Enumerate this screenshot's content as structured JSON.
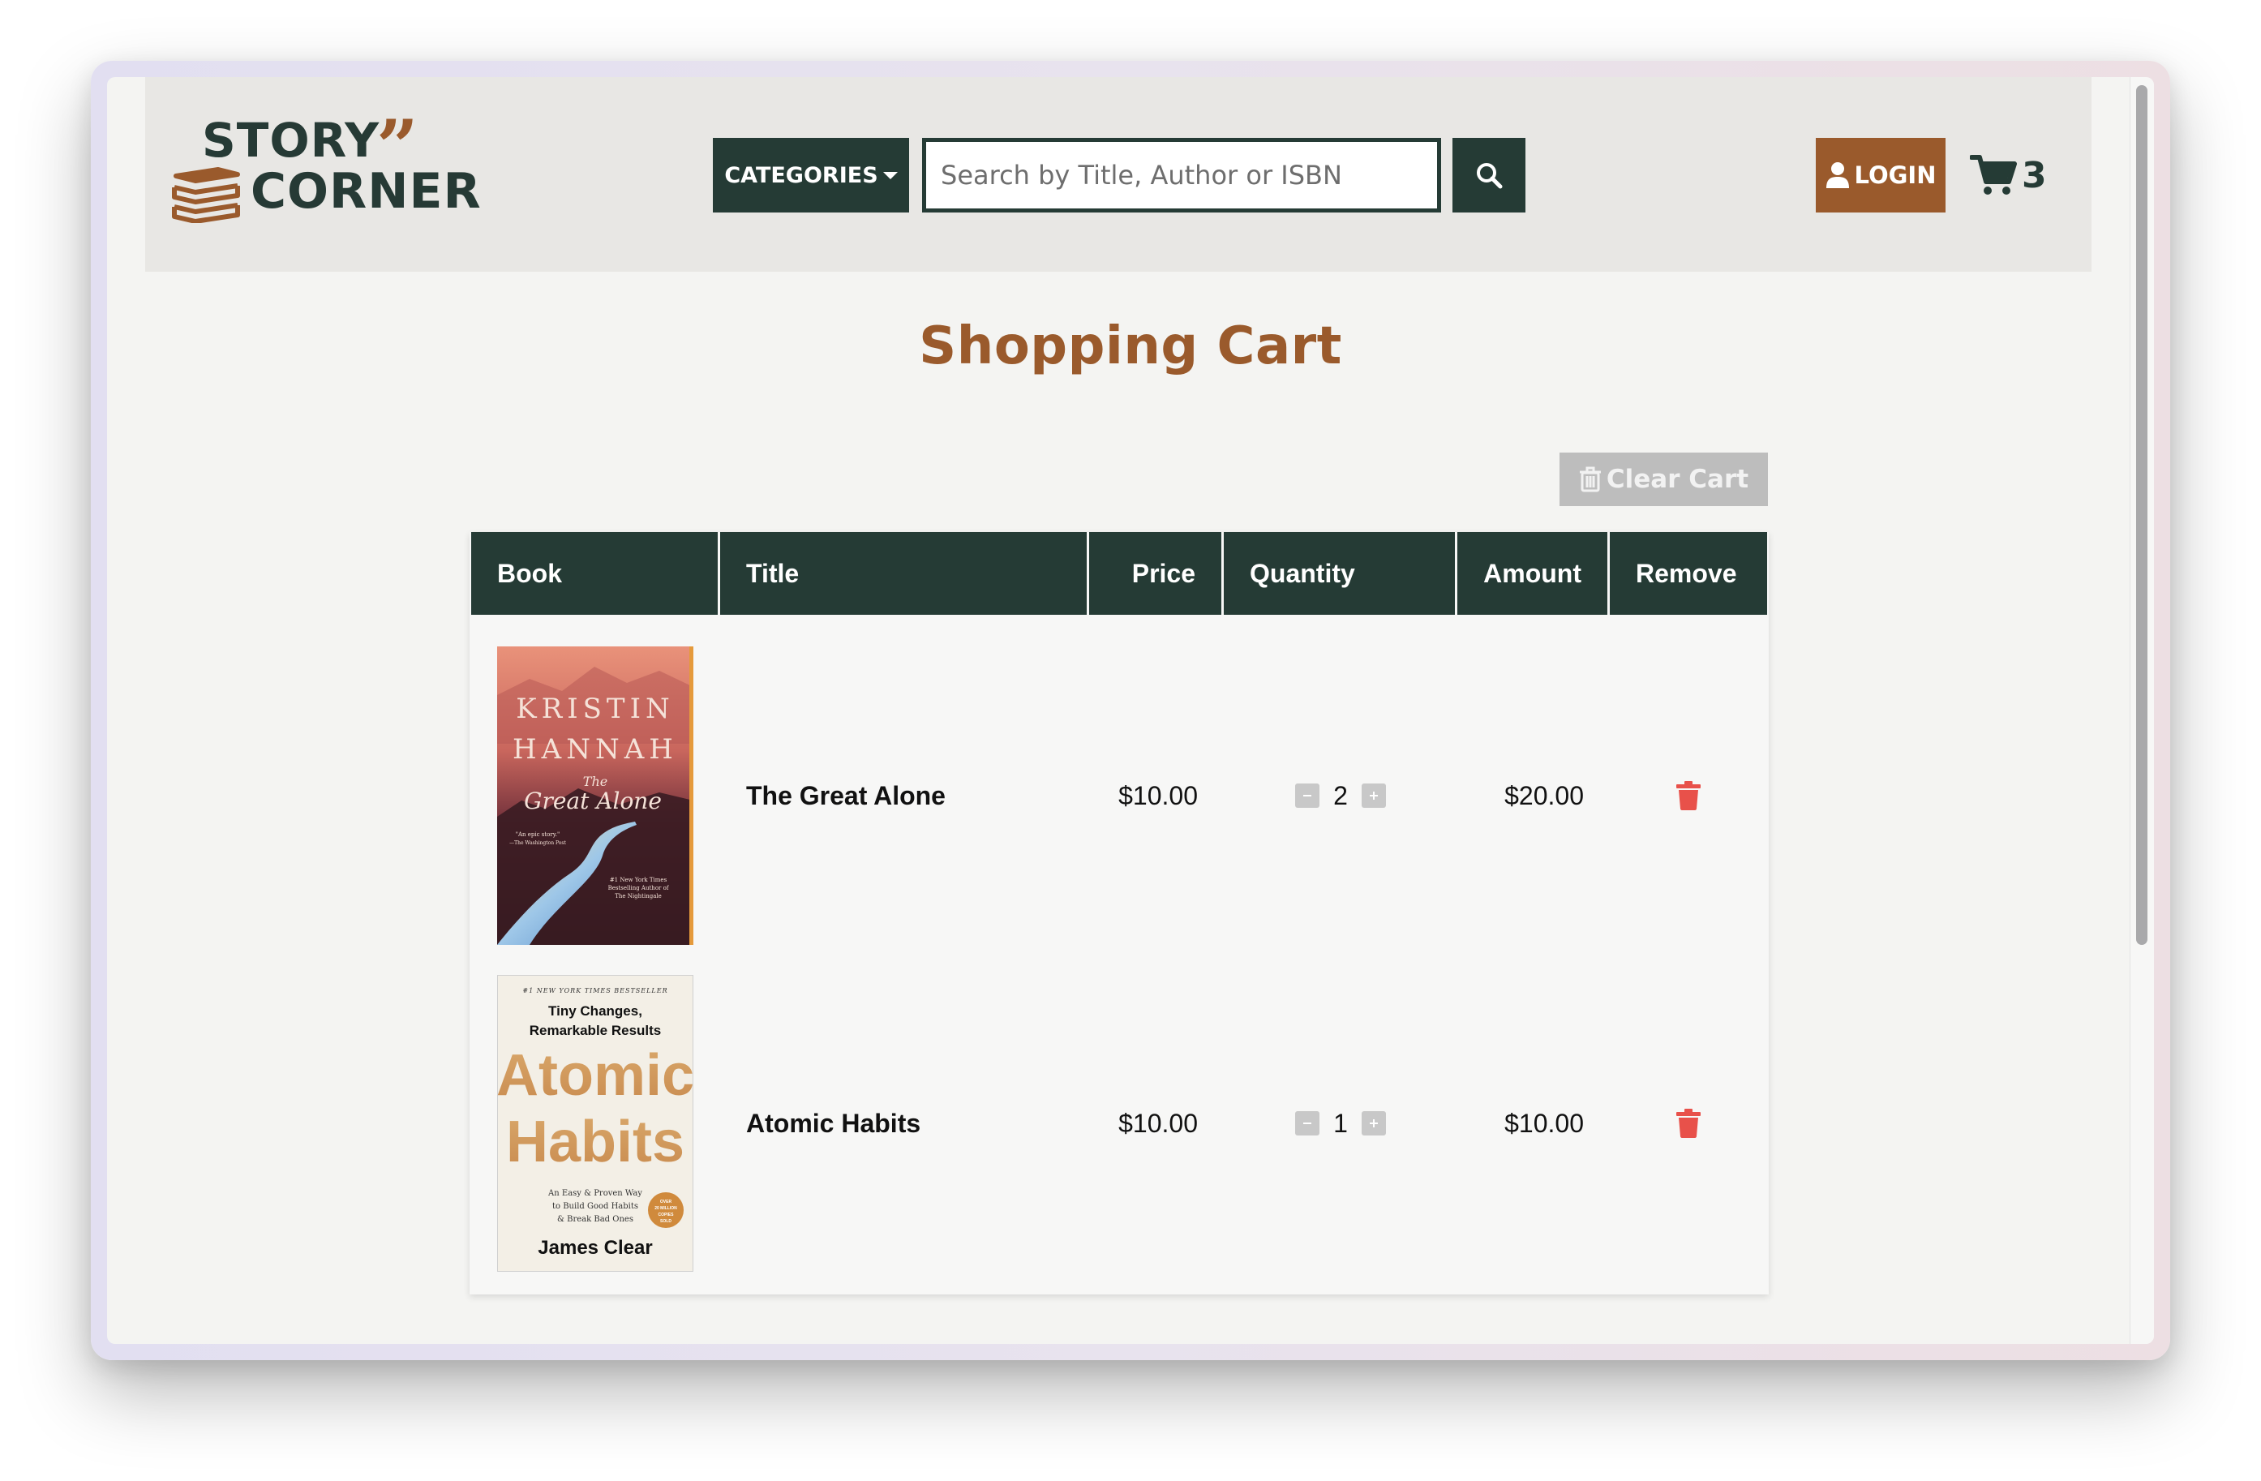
{
  "header": {
    "logo": {
      "line1": "STORY",
      "line2": "CORNER",
      "icon": "books-quote-logo"
    },
    "categories_label": "CATEGORIES",
    "search_placeholder": "Search by Title, Author or ISBN",
    "search_icon": "search-icon",
    "login_label": "LOGIN",
    "cart_count": "3"
  },
  "page": {
    "title": "Shopping Cart",
    "clear_cart_label": "Clear Cart"
  },
  "table": {
    "headers": [
      "Book",
      "Title",
      "Price",
      "Quantity",
      "Amount",
      "Remove"
    ],
    "rows": [
      {
        "cover": {
          "author": [
            "KRISTIN",
            "HANNAH"
          ],
          "title_prefix": "The",
          "title": "Great Alone",
          "quote": "\"An epic story.\"",
          "quote_source": "—The Washington Post",
          "bestseller": [
            "#1 New York Times",
            "Bestselling Author of",
            "The Nightingale"
          ]
        },
        "title": "The Great Alone",
        "price": "$10.00",
        "quantity": "2",
        "amount": "$20.00"
      },
      {
        "cover": {
          "bestseller": "#1 NEW YORK TIMES BESTSELLER",
          "tagline": [
            "Tiny Changes,",
            "Remarkable Results"
          ],
          "title": [
            "Atomic",
            "Habits"
          ],
          "subtitle": [
            "An Easy & Proven Way",
            "to Build Good Habits",
            "& Break Bad Ones"
          ],
          "badge": [
            "OVER",
            "20 MILLION",
            "COPIES",
            "SOLD"
          ],
          "author": "James Clear"
        },
        "title": "Atomic Habits",
        "price": "$10.00",
        "quantity": "1",
        "amount": "$10.00"
      }
    ]
  },
  "colors": {
    "dark_green": "#253b35",
    "brown": "#9a5a2c",
    "trash_red": "#e8514a",
    "header_bg": "#e8e7e4"
  }
}
